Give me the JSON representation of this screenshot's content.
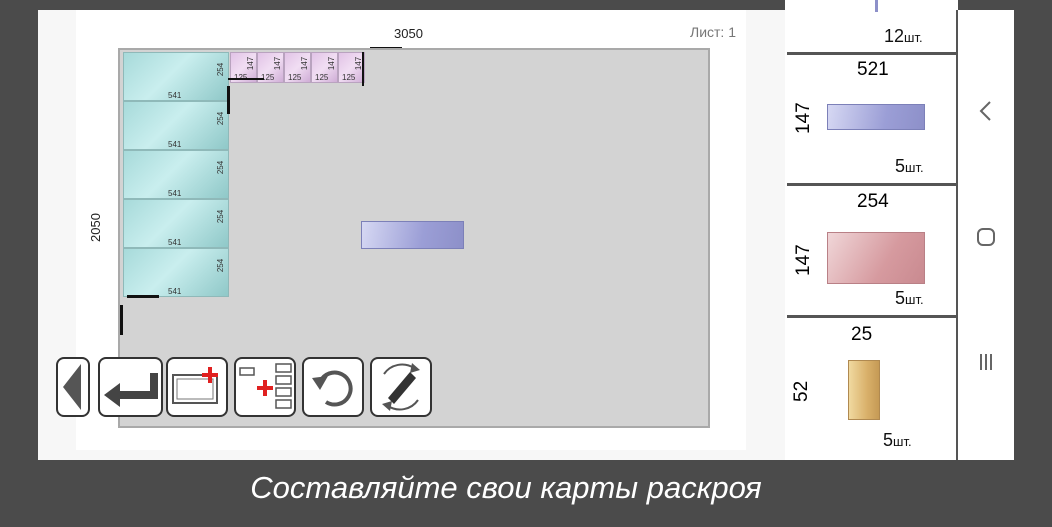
{
  "sheet": {
    "width_label": "3050",
    "height_label": "2050",
    "sheet_counter": "Лист: 1"
  },
  "placed_large": [
    {
      "w": "541",
      "h": "254"
    },
    {
      "w": "541",
      "h": "254"
    },
    {
      "w": "541",
      "h": "254"
    },
    {
      "w": "541",
      "h": "254"
    },
    {
      "w": "541",
      "h": "254"
    }
  ],
  "placed_small": [
    {
      "w": "125",
      "h": "147"
    },
    {
      "w": "125",
      "h": "147"
    },
    {
      "w": "125",
      "h": "147"
    },
    {
      "w": "125",
      "h": "147"
    },
    {
      "w": "125",
      "h": "147"
    }
  ],
  "parts_panel": {
    "cards": [
      {
        "qty": "12",
        "unit": "шт."
      },
      {
        "width": "521",
        "height": "147",
        "qty": "5",
        "unit": "шт.",
        "color": "#9b9ed6"
      },
      {
        "width": "254",
        "height": "147",
        "qty": "5",
        "unit": "шт.",
        "color": "#d69a9f"
      },
      {
        "width": "25",
        "height": "52",
        "qty": "5",
        "unit": "шт.",
        "color": "#d9b06a"
      }
    ]
  },
  "toolbar": {
    "buttons": [
      "prev-arrow-icon",
      "back-return-icon",
      "add-sheet-icon",
      "add-parts-list-icon",
      "rotate-icon",
      "auto-arrange-icon"
    ]
  },
  "system_nav": {
    "icons": [
      "back-chevron-icon",
      "home-circle-icon",
      "recents-lines-icon"
    ]
  },
  "caption": "Составляйте свои карты раскроя",
  "colors": {
    "frame": "#4b4b4b",
    "sheet": "#d3d3d3",
    "large_piece": "#a7dada",
    "small_piece": "#e1c3e6",
    "floating_piece": "#9b9ed6"
  }
}
